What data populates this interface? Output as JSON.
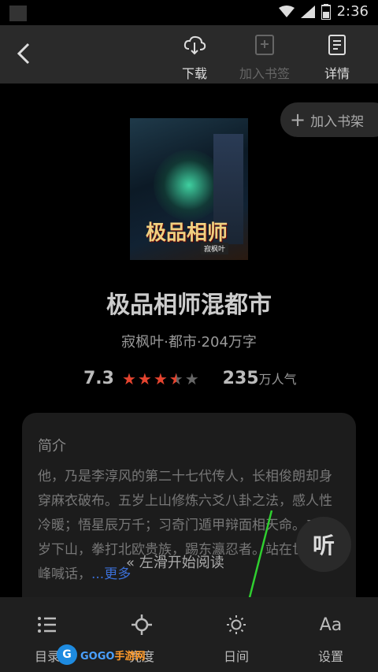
{
  "status_bar": {
    "time": "2:36"
  },
  "top_bar": {
    "download_label": "下载",
    "bookmark_label": "加入书签",
    "details_label": "详情"
  },
  "add_shelf_label": "加入书架",
  "cover": {
    "title": "极品相师",
    "author": "寂枫叶"
  },
  "book": {
    "title": "极品相师混都市",
    "meta": "寂枫叶·都市·204万字",
    "score": "7.3",
    "stars_filled": 3.5,
    "stars_total": 5,
    "popularity_value": "235",
    "popularity_unit": "万人气"
  },
  "intro": {
    "heading": "简介",
    "text": "他，乃是李淳风的第二十七代传人，长相俊朗却身穿麻衣破布。五岁上山修炼六爻八卦之法，感人性冷暖；悟星辰万千；习奇门遁甲辩面相天命。二十岁下山，拳打北欧贵族，踢东瀛忍者。站在世界巅峰喊话，",
    "more_label": "...更多"
  },
  "listen_label": "听",
  "swipe_hint": "« 左滑开始阅读",
  "bottom_nav": {
    "toc_label": "目录",
    "brightness_label": "亮度",
    "daymode_label": "日间",
    "settings_label": "设置"
  },
  "watermark": {
    "brand_left": "GOGO",
    "brand_right": "手游网",
    "logo_letter": "G"
  },
  "colors": {
    "accent_star": "#e5442f",
    "link": "#3b6fd6",
    "arrow": "#2fcf2f"
  }
}
